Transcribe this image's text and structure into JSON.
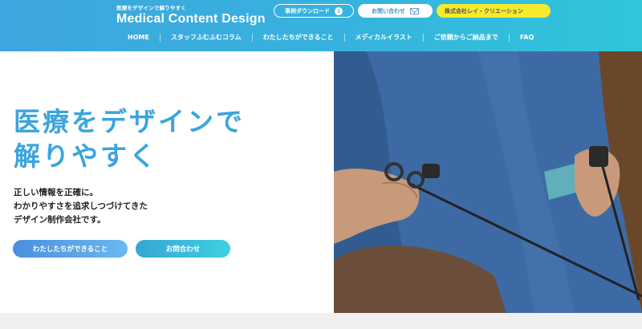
{
  "header": {
    "tagline": "医療をデザインで解りやすく",
    "site_name": "Medical Content Design",
    "buttons": {
      "download": "事例ダウンロード",
      "contact": "お問い合わせ",
      "company": "株式会社レイ・クリエーション"
    },
    "nav": [
      "HOME",
      "スタッフふむふむコラム",
      "わたしたちができること",
      "メディカルイラスト",
      "ご依頼からご納品まで",
      "FAQ"
    ]
  },
  "hero": {
    "headline_line1": "医療をデザインで",
    "headline_line2": "解りやすく",
    "sub_line1": "正しい情報を正確に。",
    "sub_line2": "わかりやすさを追求しつづけてきた",
    "sub_line3": "デザイン制作会社です。",
    "cta_what": "わたしたちができること",
    "cta_contact": "お問合わせ"
  },
  "colors": {
    "header_gradient_start": "#3ea6de",
    "header_gradient_end": "#2fc6da",
    "headline": "#3ba5dc",
    "company_button": "#f6ea2e"
  },
  "icons": [
    "download-icon",
    "mail-icon"
  ]
}
